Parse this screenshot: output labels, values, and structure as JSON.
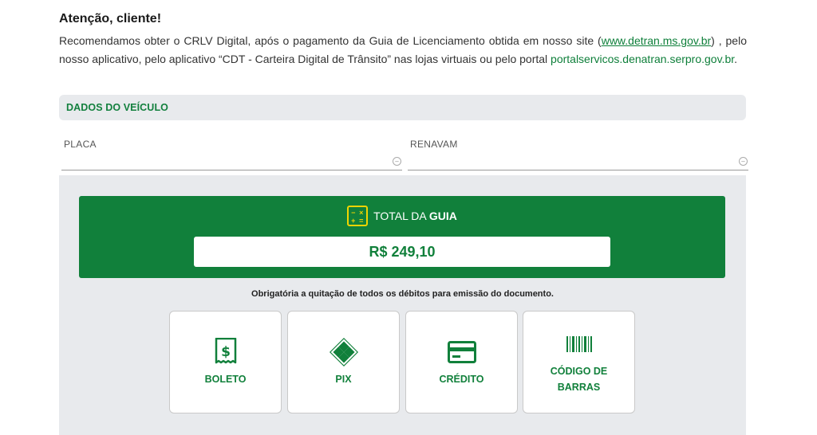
{
  "notice": {
    "title": "Atenção, cliente!",
    "text_part1": "Recomendamos obter o CRLV Digital, após o pagamento da Guia de Licenciamento obtida em nosso site (",
    "link_detran": "www.detran.ms.gov.br",
    "text_part2": ") , pelo nosso aplicativo, pelo aplicativo “CDT - Carteira Digital de Trânsito” nas lojas virtuais ou pelo portal ",
    "link_portal": "portalservicos.denatran.serpro.gov.br",
    "text_part3": "."
  },
  "vehicle": {
    "section_title": "DADOS DO VEÍCULO",
    "placa_label": "PLACA",
    "renavam_label": "RENAVAM",
    "placa_value": "",
    "renavam_value": ""
  },
  "total": {
    "label_prefix": "TOTAL DA ",
    "label_bold": "GUIA",
    "value": "R$ 249,10",
    "icon": "calculator-icon"
  },
  "payment": {
    "notice": "Obrigatória a quitação de todos os débitos para emissão do documento.",
    "options": [
      {
        "label": "BOLETO",
        "icon": "boleto-dollar-icon"
      },
      {
        "label": "PIX",
        "icon": "pix-icon"
      },
      {
        "label": "CRÉDITO",
        "icon": "credit-card-icon"
      },
      {
        "label_line1": "CÓDIGO DE",
        "label_line2": "BARRAS",
        "icon": "barcode-icon"
      }
    ]
  },
  "colors": {
    "brand_green": "#11803b",
    "accent_yellow": "#f0d400",
    "panel_gray": "#e8eaed"
  }
}
